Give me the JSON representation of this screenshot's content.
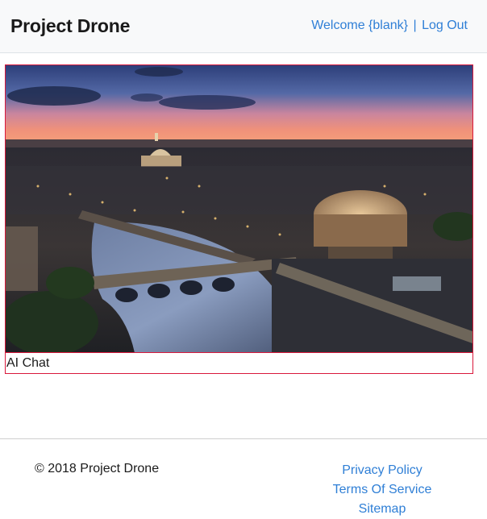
{
  "header": {
    "brand": "Project Drone",
    "welcome": "Welcome {blank}",
    "separator": "|",
    "logout": "Log Out"
  },
  "main": {
    "image_alt": "Aerial night view of Rome with the Tiber river, bridges, St. Peter's Basilica and Castel Sant'Angelo",
    "caption": "AI Chat"
  },
  "footer": {
    "copyright": "© 2018 Project Drone",
    "links": [
      "Privacy Policy",
      "Terms Of Service",
      "Sitemap"
    ]
  },
  "colors": {
    "link": "#2f7fd6",
    "card_border": "#d9183b",
    "navbar_bg": "#f8f9fa"
  }
}
